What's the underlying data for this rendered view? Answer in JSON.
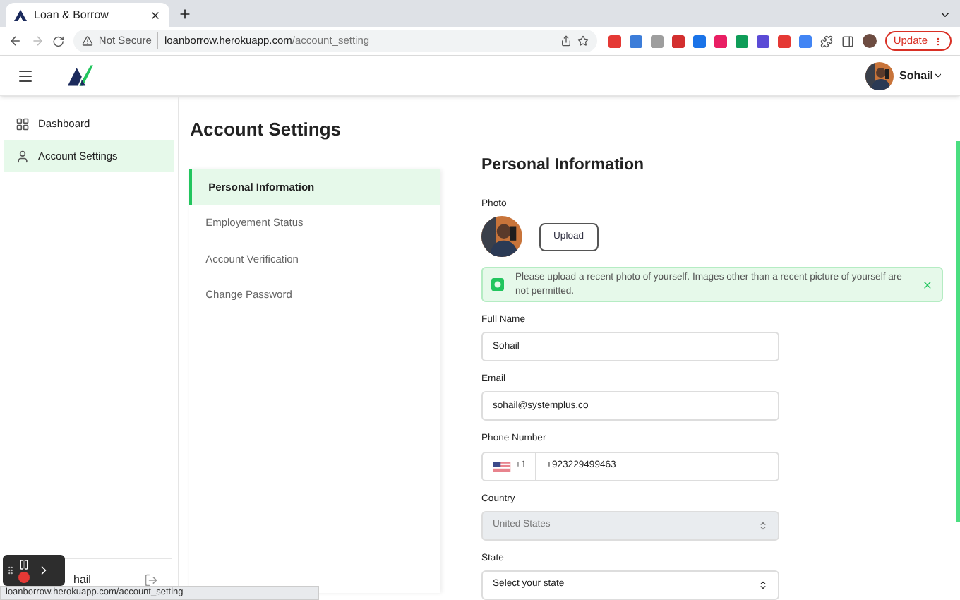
{
  "browser": {
    "tab_title": "Loan & Borrow",
    "security": "Not Secure",
    "url_host": "loanborrow.herokuapp.com",
    "url_path": "/account_setting",
    "update_button": "Update"
  },
  "header": {
    "user_name": "Sohail"
  },
  "sidebar": {
    "items": [
      {
        "label": "Dashboard",
        "selected": false
      },
      {
        "label": "Account Settings",
        "selected": true
      }
    ],
    "user_name": "hail"
  },
  "page_title": "Account Settings",
  "settings_nav": [
    {
      "label": "Personal Information",
      "selected": true
    },
    {
      "label": "Employement Status",
      "selected": false
    },
    {
      "label": "Account Verification",
      "selected": false
    },
    {
      "label": "Change Password",
      "selected": false
    }
  ],
  "form": {
    "title": "Personal Information",
    "photo_label": "Photo",
    "upload_button": "Upload",
    "notice": "Please upload a recent photo of yourself. Images other than a recent picture of yourself are not permitted.",
    "fields": [
      {
        "kind": "text",
        "label": "Full Name",
        "value": "Sohail"
      },
      {
        "kind": "text",
        "label": "Email",
        "value": "sohail@systemplus.co"
      },
      {
        "kind": "phone",
        "label": "Phone Number",
        "dial_code": "+1",
        "value": "+923229499463"
      },
      {
        "kind": "select",
        "label": "Country",
        "value": "United States",
        "disabled": true
      },
      {
        "kind": "select",
        "label": "State",
        "value": "Select your state",
        "disabled": false
      }
    ]
  },
  "status_bar": "loanborrow.herokuapp.com/account_setting"
}
